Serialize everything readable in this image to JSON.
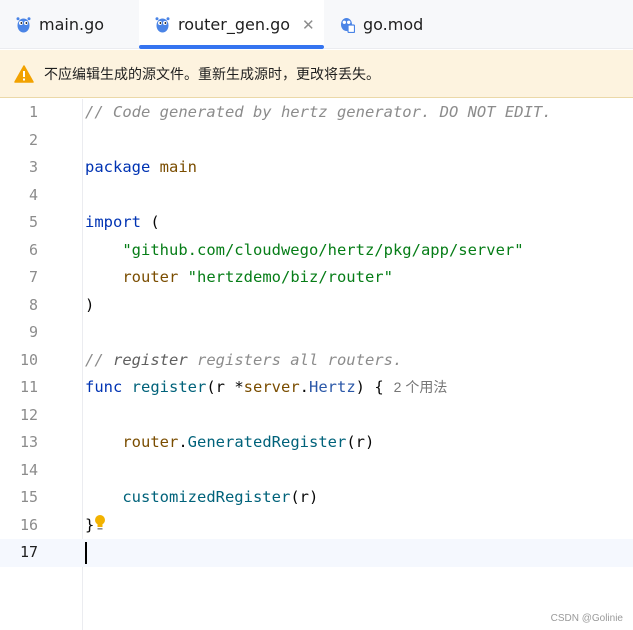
{
  "tabs": [
    {
      "label": "main.go",
      "icon": "gopher-icon"
    },
    {
      "label": "router_gen.go",
      "icon": "gopher-icon",
      "active": true
    },
    {
      "label": "go.mod",
      "icon": "go-mod-icon"
    }
  ],
  "banner": {
    "text": "不应编辑生成的源文件。重新生成源时，更改将丢失。"
  },
  "lines": [
    "1",
    "2",
    "3",
    "4",
    "5",
    "6",
    "7",
    "8",
    "9",
    "10",
    "11",
    "12",
    "13",
    "14",
    "15",
    "16",
    "17"
  ],
  "code": {
    "l1_comment": "// Code generated by hertz generator. DO NOT EDIT.",
    "l3_kw": "package",
    "l3_name": "main",
    "l5_kw": "import",
    "l5_paren": " (",
    "l6_str": "\"github.com/cloudwego/hertz/pkg/app/server\"",
    "l7_alias": "router",
    "l7_str": "\"hertzdemo/biz/router\"",
    "l8_paren": ")",
    "l10_slash": "// ",
    "l10_bold": "register",
    "l10_rest": " registers all routers.",
    "l11_kw": "func",
    "l11_fn": "register",
    "l11_p1": "(r *",
    "l11_pkg": "server",
    "l11_dot": ".",
    "l11_type": "Hertz",
    "l11_p2": ") {",
    "l11_hint": "2 个用法",
    "l13_pkg": "router",
    "l13_dot": ".",
    "l13_fn": "GeneratedRegister",
    "l13_args": "(r)",
    "l15_fn": "customizedRegister",
    "l15_args": "(r)",
    "l16_brace": "}"
  },
  "watermark": "CSDN @Golinie"
}
